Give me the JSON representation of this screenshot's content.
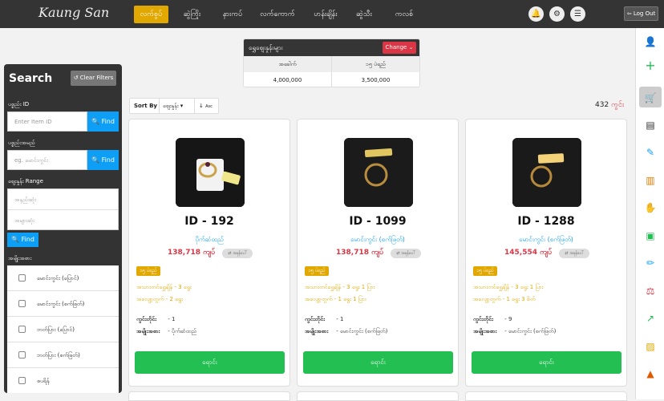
{
  "app": {
    "logo": "Kaung San"
  },
  "nav": [
    "လက်စွပ်",
    "ဆွဲကြိုး",
    "နားကပ်",
    "လက်ကောက်",
    "ဟန်းချိန်း",
    "ဆွဲသီး",
    "ကလစ်"
  ],
  "header": {
    "logout_label": "Log Out"
  },
  "price_box": {
    "title": "ရွှေဈေးနှုန်းများ",
    "change_label": "Change",
    "col1": "အခေါက်",
    "col2": "၁၅ ပဲရည်",
    "val1": "4,000,000",
    "val2": "3,500,000"
  },
  "search": {
    "title": "Search",
    "clear_label": "Clear Filters",
    "id_label": "ပစ္စည်း ID",
    "id_placeholder": "Enter Item ID",
    "find_label": "Find",
    "name_label": "ပစ္စည်းအမည်",
    "name_placeholder": "eg. မောင်းကွင်း",
    "range_label": "ဈေးနှုန်း Range",
    "min_placeholder": "အနည်းဆုံး",
    "max_placeholder": "အများဆုံး",
    "types_label": "အမျိုးအစား",
    "types": [
      "မောင်းကွင်း (ပြောင်)",
      "မောင်းကွင်း (စက်ဖြတ်)",
      "ဘတ်ပြား (ပြောင်)",
      "ဘတ်ပြား (စက်ဖြတ်)",
      "စပရိန်"
    ]
  },
  "sort": {
    "label": "Sort By",
    "field": "ဈေးနှုန်း",
    "order": "Asc"
  },
  "count": {
    "value": "432",
    "unit": "ကွင်း"
  },
  "cards": [
    {
      "id": "ID - 192",
      "cat": "ပိုက်ဆံထည်",
      "price": "138,718 ကျပ်",
      "upd": "အခုန်ပေါ်",
      "karat": "၁၅ ပဲရည်",
      "gold_k": "အသားတင်ရွှေချိန်",
      "gold_v": "- 3 ရွေး",
      "loss_k": "အလျော့တွက်",
      "loss_v": "- 2 ရွေး",
      "qty_k": "ကွင်းတိုင်း",
      "qty_v": "- 1",
      "type_k": "အမျိုးအစား",
      "type_v": "- ပိုက်ဆံထည်",
      "buy": "ရောင်း"
    },
    {
      "id": "ID - 1099",
      "cat": "မောင်းကွင်း (စက်ဖြတ်)",
      "price": "138,718 ကျပ်",
      "upd": "အခုန်ပေါ်",
      "karat": "၁၅ ပဲရည်",
      "gold_k": "အသားတင်ရွှေချိန်",
      "gold_v": "- 3 ရွေး 1 ပြား",
      "loss_k": "အလျော့တွက်",
      "loss_v": "- 1 ရွေး 1 ပြား",
      "qty_k": "ကွင်းတိုင်း",
      "qty_v": "- 1",
      "type_k": "အမျိုးအစား",
      "type_v": "- မောင်းကွင်း (စက်ဖြတ်)",
      "buy": "ရောင်း"
    },
    {
      "id": "ID - 1288",
      "cat": "မောင်းကွင်း (စက်ဖြတ်)",
      "price": "145,554 ကျပ်",
      "upd": "အခုန်ပေါ်",
      "karat": "၁၅ ပဲရည်",
      "gold_k": "အသားတင်ရွှေချိန်",
      "gold_v": "- 3 ရွေး 1 ပြား",
      "loss_k": "အလျော့တွက်",
      "loss_v": "- 1 ရွေး 3 စိတ်",
      "qty_k": "ကွင်းတိုင်း",
      "qty_v": "- 9",
      "type_k": "အမျိုးအစား",
      "type_v": "- မောင်းကွင်း (စက်ဖြတ်)",
      "buy": "ရောင်း"
    }
  ],
  "sidebar_icons": [
    "user-icon",
    "plus-icon",
    "cart-icon",
    "receipt-icon",
    "edit-doc-icon",
    "invoice-icon",
    "hand-coin-icon",
    "money-icon",
    "pencil-icon",
    "scale-icon",
    "chart-icon",
    "image-icon",
    "boxes-icon"
  ]
}
